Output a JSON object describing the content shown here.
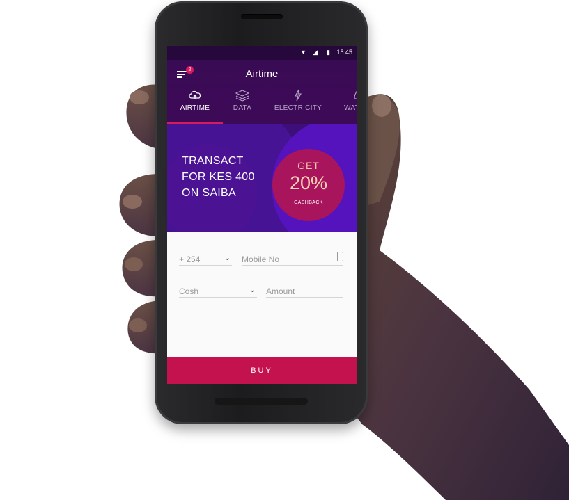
{
  "status_bar": {
    "time": "15:45",
    "icons": [
      "wifi-icon",
      "signal-icon",
      "battery-icon"
    ]
  },
  "app_bar": {
    "title": "Airtime",
    "notification_count": "2"
  },
  "tabs": [
    {
      "label": "AIRTIME",
      "icon": "cloud-upload-icon",
      "active": true
    },
    {
      "label": "DATA",
      "icon": "layers-icon",
      "active": false
    },
    {
      "label": "ELECTRICITY",
      "icon": "bolt-icon",
      "active": false
    },
    {
      "label": "WAT",
      "icon": "drop-icon",
      "active": false
    }
  ],
  "banner": {
    "line1": "TRANSACT",
    "line2": "FOR KES 400",
    "line3": "ON SAIBA",
    "badge_top": "GET",
    "badge_value": "20%",
    "badge_bottom": "CASHBACK",
    "carousel_pages": 5,
    "carousel_active": 2
  },
  "form": {
    "country_code": "+ 254",
    "mobile_placeholder": "Mobile No",
    "payment_method": "Cosh",
    "amount_placeholder": "Amount"
  },
  "buy_label": "BUY",
  "colors": {
    "accent": "#c4124f",
    "header": "#3a0b55",
    "banner": "#451394"
  }
}
